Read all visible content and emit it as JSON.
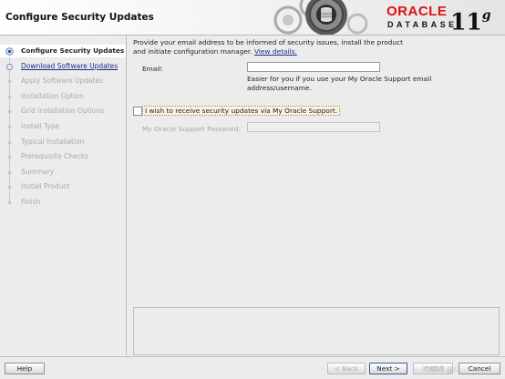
{
  "header": {
    "title": "Configure Security Updates",
    "logo_oracle": "ORACLE",
    "logo_database": "DATABASE",
    "version": "11",
    "version_suffix": "g"
  },
  "nav": {
    "items": [
      {
        "label": "Configure Security Updates",
        "state": "current"
      },
      {
        "label": "Download Software Updates",
        "state": "link"
      },
      {
        "label": "Apply Software Updates",
        "state": "disabled"
      },
      {
        "label": "Installation Option",
        "state": "disabled"
      },
      {
        "label": "Grid Installation Options",
        "state": "disabled"
      },
      {
        "label": "Install Type",
        "state": "disabled"
      },
      {
        "label": "Typical Installation",
        "state": "disabled"
      },
      {
        "label": "Prerequisite Checks",
        "state": "disabled"
      },
      {
        "label": "Summary",
        "state": "disabled"
      },
      {
        "label": "Install Product",
        "state": "disabled"
      },
      {
        "label": "Finish",
        "state": "disabled"
      }
    ]
  },
  "main": {
    "intro_line1": "Provide your email address to be informed of security issues, install the product",
    "intro_line2": "and initiate configuration manager.",
    "view_details": "View details.",
    "email_label": "Email:",
    "email_value": "",
    "email_help_line1": "Easier for you if you use your My Oracle Support email",
    "email_help_line2": "address/username.",
    "checkbox_label": "I wish to receive security updates via My Oracle Support.",
    "checkbox_checked": false,
    "password_label": "My Oracle Support Password:",
    "password_value": ""
  },
  "buttons": {
    "help": "Help",
    "back": "< Back",
    "next": "Next >",
    "install": "Install",
    "cancel": "Cancel"
  },
  "watermark": "CSDN @c"
}
